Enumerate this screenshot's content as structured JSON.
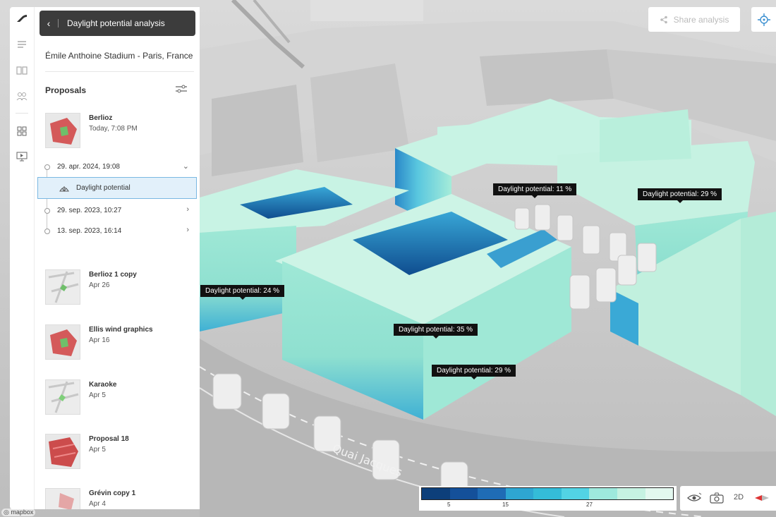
{
  "header": {
    "back_icon": "chevron-left-icon",
    "title": "Daylight potential analysis"
  },
  "location": "Émile Anthoine Stadium - Paris, France",
  "proposals_heading": "Proposals",
  "proposals_top": {
    "name": "Berlioz",
    "date": "Today, 7:08 PM"
  },
  "versions": [
    {
      "label": "29. apr. 2024, 19:08",
      "expanded": true
    },
    {
      "label": "29. sep. 2023, 10:27",
      "expanded": false
    },
    {
      "label": "13. sep. 2023, 16:14",
      "expanded": false
    }
  ],
  "active_analysis": "Daylight potential",
  "proposals": [
    {
      "name": "Berlioz 1 copy",
      "date": "Apr 26"
    },
    {
      "name": "Ellis wind graphics",
      "date": "Apr 16"
    },
    {
      "name": "Karaoke",
      "date": "Apr 5"
    },
    {
      "name": "Proposal 18",
      "date": "Apr 5"
    },
    {
      "name": "Grévin copy 1",
      "date": "Apr 4"
    }
  ],
  "share_button": "Share analysis",
  "tooltips": [
    "Daylight potential: 11 %",
    "Daylight potential: 29 %",
    "Daylight potential: 24 %",
    "Daylight potential: 35 %",
    "Daylight potential: 29 %"
  ],
  "legend": {
    "ticks": [
      "5",
      "15",
      "27"
    ],
    "colors": [
      "#0d3f7a",
      "#14509a",
      "#1f6cb5",
      "#2ea6d2",
      "#34bcd8",
      "#52d3e4",
      "#9ee9dd",
      "#c6f2e2",
      "#e3f8ef"
    ]
  },
  "tools": {
    "view_mode": "2D"
  },
  "attribution": "mapbox"
}
